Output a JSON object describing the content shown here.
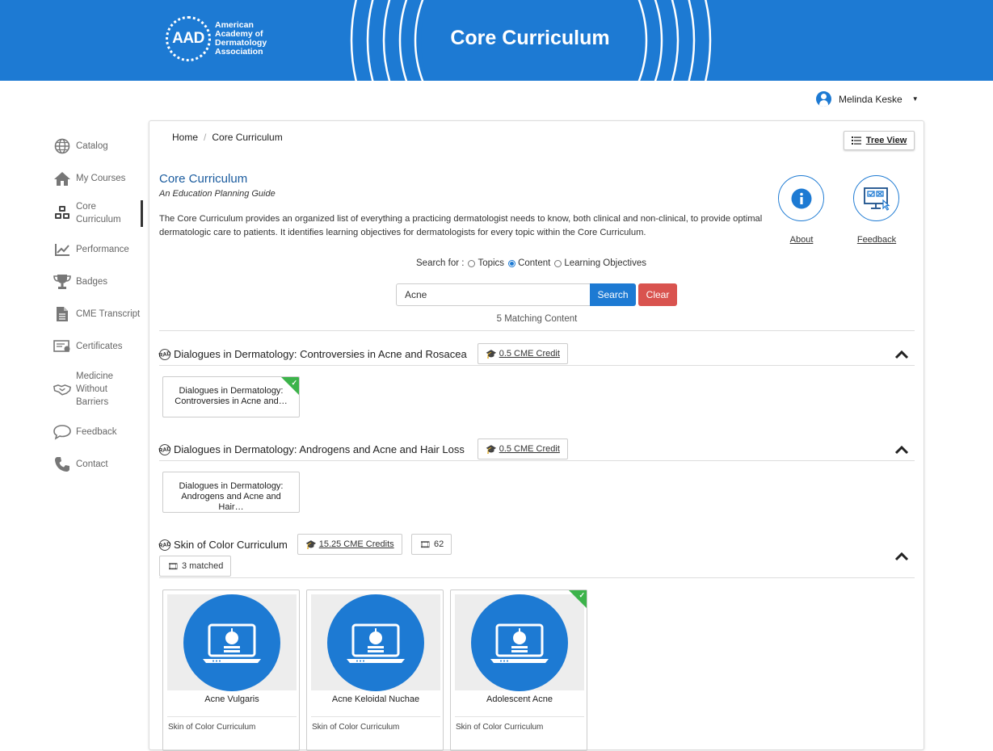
{
  "header": {
    "logo_abbr": "AAD",
    "logo_lines": [
      "American",
      "Academy of",
      "Dermatology",
      "Association"
    ],
    "title": "Core Curriculum"
  },
  "user": {
    "name": "Melinda Keske"
  },
  "sidebar": {
    "items": [
      {
        "label": "Catalog",
        "icon": "globe-icon"
      },
      {
        "label": "My Courses",
        "icon": "home-icon"
      },
      {
        "label": "Core Curriculum",
        "icon": "cubes-icon",
        "active": true
      },
      {
        "label": "Performance",
        "icon": "chart-line-icon"
      },
      {
        "label": "Badges",
        "icon": "trophy-icon"
      },
      {
        "label": "CME Transcript",
        "icon": "document-icon"
      },
      {
        "label": "Certificates",
        "icon": "certificate-icon"
      },
      {
        "label": "Medicine Without Barriers",
        "icon": "handshake-icon"
      },
      {
        "label": "Feedback",
        "icon": "speech-bubble-icon"
      },
      {
        "label": "Contact",
        "icon": "phone-icon"
      }
    ]
  },
  "breadcrumb": {
    "home": "Home",
    "current": "Core Curriculum"
  },
  "tree_view": {
    "label": "Tree View"
  },
  "main": {
    "title": "Core Curriculum",
    "subtitle": "An Education Planning Guide",
    "description": "The Core Curriculum provides an organized list of everything a practicing dermatologist needs to know, both clinical and non-clinical, to provide optimal dermatologic care to patients. It identifies learning objectives for dermatologists for every topic within the Core Curriculum.",
    "about_label": "About",
    "feedback_label": "Feedback"
  },
  "search": {
    "label": "Search for :",
    "options": [
      "Topics",
      "Content",
      "Learning Objectives"
    ],
    "selected": "Content",
    "value": "Acne",
    "search_button": "Search",
    "clear_button": "Clear",
    "result_text": "5 Matching Content"
  },
  "sections": [
    {
      "tag": "RAD",
      "title": "Dialogues in Dermatology: Controversies in Acne and Rosacea",
      "credit": "0.5 CME Credit",
      "items": [
        {
          "title": "Dialogues in Dermatology: Controversies in Acne and…",
          "completed": true
        }
      ]
    },
    {
      "tag": "RAD",
      "title": "Dialogues in Dermatology: Androgens and Acne and Hair Loss",
      "credit": "0.5 CME Credit",
      "items": [
        {
          "title": "Dialogues in Dermatology: Androgens and Acne and Hair…",
          "completed": false
        }
      ]
    },
    {
      "tag": "RAD",
      "title": "Skin of Color Curriculum",
      "credit": "15.25 CME Credits",
      "count": "62",
      "matched": "3 matched",
      "items": [
        {
          "title": "Acne Vulgaris",
          "subtitle": "Skin of Color Curriculum",
          "completed": false
        },
        {
          "title": "Acne Keloidal Nuchae",
          "subtitle": "Skin of Color Curriculum",
          "completed": false
        },
        {
          "title": "Adolescent Acne",
          "subtitle": "Skin of Color Curriculum",
          "completed": true
        }
      ]
    }
  ],
  "colors": {
    "brand_blue": "#1d7ad3",
    "danger_red": "#d9534f",
    "complete_green": "#3cb34a",
    "title_blue": "#1a5b9e"
  }
}
